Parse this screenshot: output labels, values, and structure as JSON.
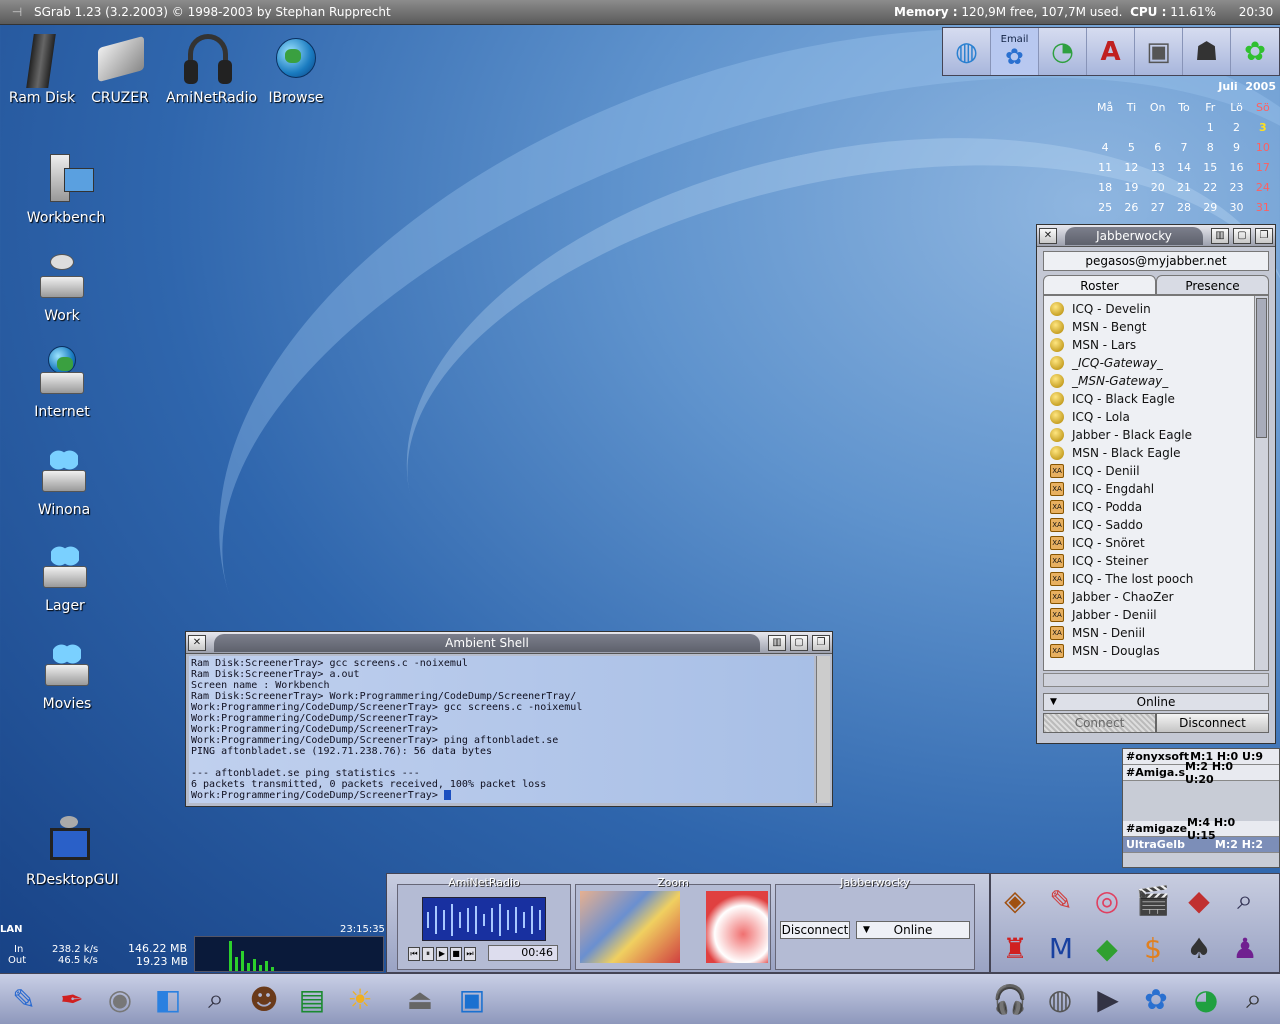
{
  "topbar": {
    "title": "SGrab  1.23  (3.2.2003)  ©  1998-2003  by  Stephan  Rupprecht",
    "memory_label": "Memory :",
    "memory": "120,9M free, 107,7M used.",
    "cpu_label": "CPU :",
    "cpu": "11.61%",
    "clock": "20:30"
  },
  "desktop_icons": [
    {
      "label": "Ram Disk"
    },
    {
      "label": "CRUZER"
    },
    {
      "label": "AmiNetRadio"
    },
    {
      "label": "IBrowse"
    },
    {
      "label": "Workbench"
    },
    {
      "label": "Work"
    },
    {
      "label": "Internet"
    },
    {
      "label": "Winona"
    },
    {
      "label": "Lager"
    },
    {
      "label": "Movies"
    },
    {
      "label": "RDesktopGUI"
    }
  ],
  "dock": {
    "email_label": "Email"
  },
  "calendar": {
    "month": "Juli",
    "year": "2005",
    "weekdays": [
      "Må",
      "Ti",
      "On",
      "To",
      "Fr",
      "Lö",
      "Sö"
    ],
    "weeks": [
      [
        "",
        "",
        "",
        "",
        "1",
        "2",
        "3"
      ],
      [
        "4",
        "5",
        "6",
        "7",
        "8",
        "9",
        "10"
      ],
      [
        "11",
        "12",
        "13",
        "14",
        "15",
        "16",
        "17"
      ],
      [
        "18",
        "19",
        "20",
        "21",
        "22",
        "23",
        "24"
      ],
      [
        "25",
        "26",
        "27",
        "28",
        "29",
        "30",
        "31"
      ]
    ],
    "today": "3"
  },
  "jabberwocky": {
    "title": "Jabberwocky",
    "jid": "pegasos@myjabber.net",
    "tab_roster": "Roster",
    "tab_presence": "Presence",
    "contacts": [
      {
        "name": "ICQ - Develin",
        "status": "online"
      },
      {
        "name": "MSN - Bengt",
        "status": "online"
      },
      {
        "name": "MSN - Lars",
        "status": "online"
      },
      {
        "name": "_ICQ-Gateway_",
        "status": "online",
        "italic": true
      },
      {
        "name": "_MSN-Gateway_",
        "status": "online",
        "italic": true
      },
      {
        "name": "ICQ - Black Eagle",
        "status": "online"
      },
      {
        "name": "ICQ - Lola",
        "status": "online"
      },
      {
        "name": "Jabber - Black Eagle",
        "status": "online"
      },
      {
        "name": "MSN - Black Eagle",
        "status": "online"
      },
      {
        "name": "ICQ - Deniil",
        "status": "xa"
      },
      {
        "name": "ICQ - Engdahl",
        "status": "xa"
      },
      {
        "name": "ICQ - Podda",
        "status": "xa"
      },
      {
        "name": "ICQ - Saddo",
        "status": "xa"
      },
      {
        "name": "ICQ - Snöret",
        "status": "xa"
      },
      {
        "name": "ICQ - Steiner",
        "status": "xa"
      },
      {
        "name": "ICQ - The lost pooch",
        "status": "xa"
      },
      {
        "name": "Jabber - ChaoZer",
        "status": "xa"
      },
      {
        "name": "Jabber - Deniil",
        "status": "xa"
      },
      {
        "name": "MSN - Deniil",
        "status": "xa"
      },
      {
        "name": "MSN - Douglas",
        "status": "xa"
      }
    ],
    "status": "Online",
    "connect": "Connect",
    "disconnect": "Disconnect"
  },
  "irc": [
    {
      "channel": "#onyxsoft",
      "stats": "M:1 H:0 U:9"
    },
    {
      "channel": "#Amiga.s",
      "stats": "M:2 H:0 U:20"
    },
    {
      "channel": "#amigaze",
      "stats": "M:4 H:0 U:15"
    },
    {
      "channel": "UltraGelb",
      "stats": "M:2 H:2"
    }
  ],
  "shell": {
    "title": "Ambient  Shell",
    "lines": [
      "Ram Disk:ScreenerTray> gcc screens.c -noixemul",
      "Ram Disk:ScreenerTray> a.out",
      "Screen name : Workbench",
      "Ram Disk:ScreenerTray> Work:Programmering/CodeDump/ScreenerTray/",
      "Work:Programmering/CodeDump/ScreenerTray> gcc screens.c -noixemul",
      "Work:Programmering/CodeDump/ScreenerTray>",
      "Work:Programmering/CodeDump/ScreenerTray>",
      "Work:Programmering/CodeDump/ScreenerTray> ping aftonbladet.se",
      "PING aftonbladet.se (192.71.238.76): 56 data bytes",
      "",
      "--- aftonbladet.se ping statistics ---",
      "6 packets transmitted, 0 packets received, 100% packet loss",
      "Work:Programmering/CodeDump/ScreenerTray> "
    ]
  },
  "lan": {
    "label": "LAN",
    "time": "23:15:35",
    "in_label": "In",
    "out_label": "Out",
    "in_rate": "238.2 k/s",
    "out_rate": "46.5 k/s",
    "in_total": "146.22 MB",
    "out_total": "19.23 MB"
  },
  "panel": {
    "aminetradio_label": "AmiNetRadio",
    "time": "00:46",
    "zoom_label": "Zoom",
    "jabber_label": "Jabberwocky",
    "disconnect": "Disconnect",
    "online": "Online"
  }
}
